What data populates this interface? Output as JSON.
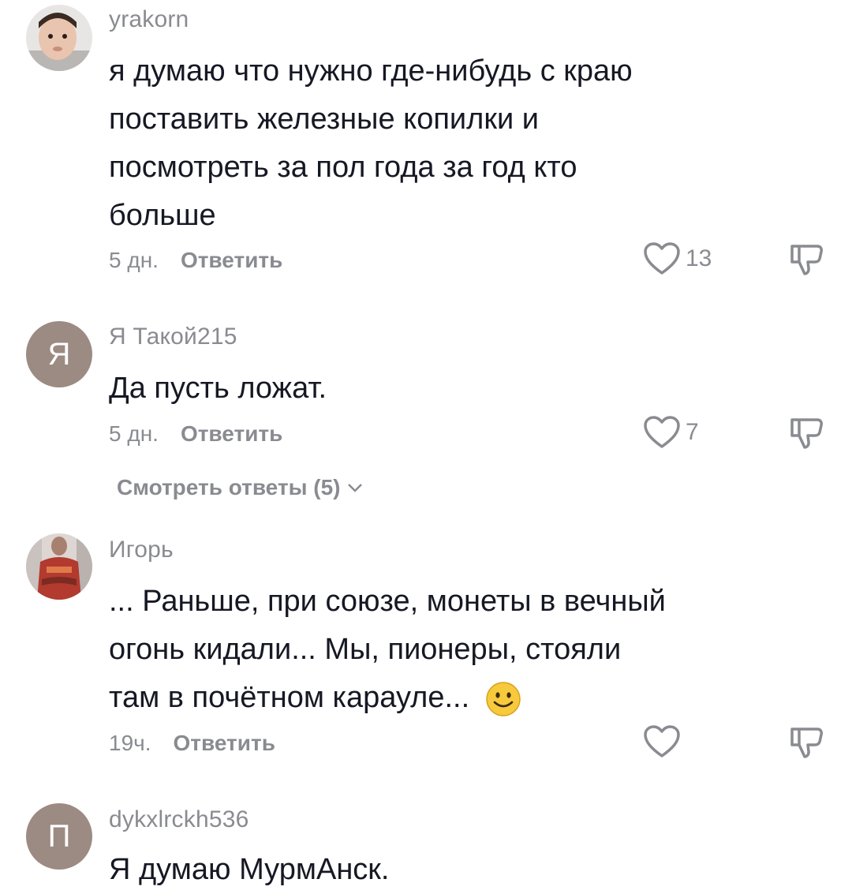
{
  "comments": [
    {
      "username": "yrakorn",
      "text_lines": [
        "я думаю что нужно где-нибудь с краю",
        "поставить железные копилки и",
        "посмотреть за пол года за год кто",
        "больше"
      ],
      "time": "5 дн.",
      "reply_label": "Ответить",
      "likes": "13"
    },
    {
      "username": "Я Такой215",
      "avatar_letter": "Я",
      "text_lines": [
        "Да пусть ложат."
      ],
      "time": "5 дн.",
      "reply_label": "Ответить",
      "likes": "7",
      "view_replies": "Смотреть ответы (5)"
    },
    {
      "username": "Игорь",
      "text_lines": [
        "... Раньше, при союзе, монеты в вечный",
        "огонь кидали... Мы, пионеры, стояли",
        "там в почётном карауле..."
      ],
      "time": "19ч.",
      "reply_label": "Ответить",
      "likes": ""
    },
    {
      "username": "dykxlrckh536",
      "avatar_letter": "П",
      "text_lines": [
        "Я думаю МурмАнск."
      ]
    }
  ],
  "icons": {
    "like": "heart-outline-icon",
    "dislike": "thumbs-down-icon",
    "expand": "chevron-down-icon",
    "emoji": "smiley-emoji-icon"
  },
  "colors": {
    "text": "#161823",
    "secondary": "#8a8b91",
    "letter_avatar_bg": "#9c8b83",
    "emoji_yellow": "#f7c93c"
  }
}
